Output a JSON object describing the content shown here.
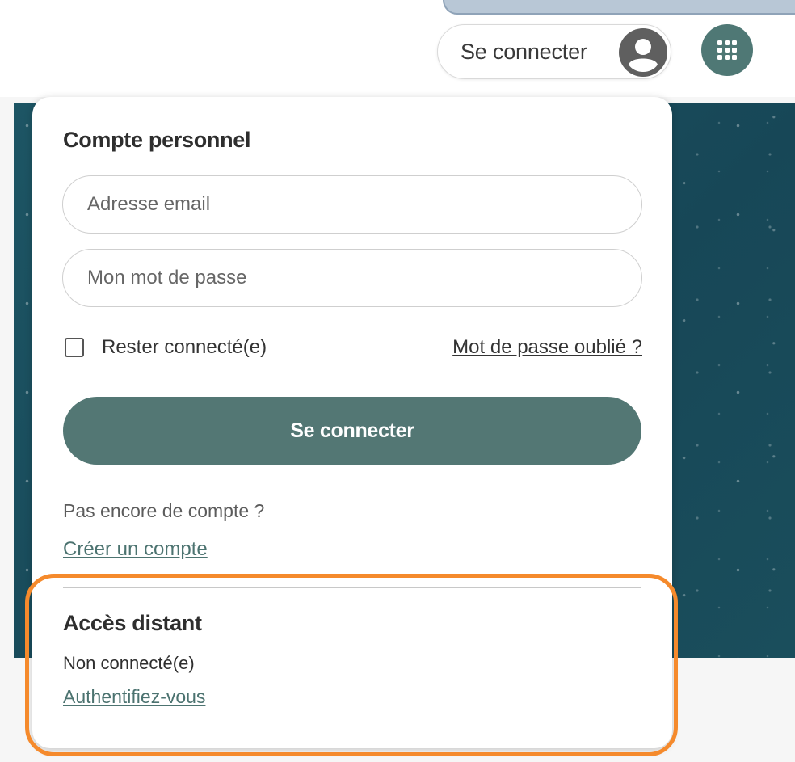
{
  "header": {
    "login_label": "Se connecter",
    "avatar_icon": "user-avatar-icon",
    "apps_icon": "apps-grid-icon",
    "accent_color": "#4f7875"
  },
  "login_panel": {
    "title": "Compte personnel",
    "email_placeholder": "Adresse email",
    "email_value": "",
    "password_placeholder": "Mon mot de passe",
    "password_value": "",
    "remember_label": "Rester connecté(e)",
    "remember_checked": false,
    "forgot_link": "Mot de passe oublié ?",
    "submit_label": "Se connecter",
    "no_account_text": "Pas encore de compte ?",
    "create_account_link": "Créer un compte"
  },
  "remote_access": {
    "title": "Accès distant",
    "status": "Non connecté(e)",
    "auth_link": "Authentifiez-vous",
    "highlight_color": "#f58a2c"
  }
}
